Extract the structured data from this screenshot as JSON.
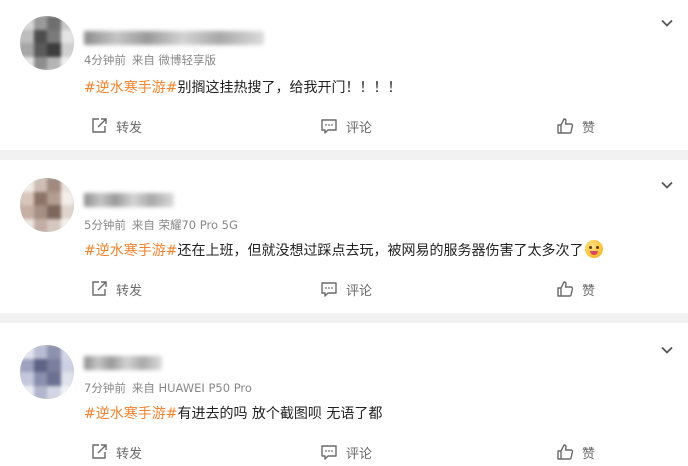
{
  "posts": [
    {
      "meta_time": "4分钟前",
      "meta_source": "来自 微博轻享版",
      "hashtag": "#逆水寒手游#",
      "text": "别搁这挂热搜了，给我开门！！！！",
      "repost_label": "转发",
      "comment_label": "评论",
      "like_label": "赞",
      "avatar_colors": [
        "#d8d8d8",
        "#9a9a9a",
        "#6f6f6f",
        "#c9c9c9",
        "#bdbdbd",
        "#4e4e4e",
        "#7b7b7b",
        "#e3e3e3",
        "#a6a6a6",
        "#5a5a5a",
        "#3d3d3d",
        "#cfcfcf",
        "#e6e6e6",
        "#8e8e8e",
        "#b5b5b5",
        "#f0f0f0"
      ]
    },
    {
      "meta_time": "5分钟前",
      "meta_source": "来自 荣耀70 Pro 5G",
      "hashtag": "#逆水寒手游#",
      "text": "还在上班，但就没想过踩点去玩，被网易的服务器伤害了太多次了",
      "repost_label": "转发",
      "comment_label": "评论",
      "like_label": "赞",
      "avatar_colors": [
        "#f1ece8",
        "#cdbdb4",
        "#a08a80",
        "#ebe3df",
        "#d9c6bb",
        "#8c7367",
        "#b49d91",
        "#f3eeea",
        "#c6afa4",
        "#a58f85",
        "#7e685e",
        "#e0d4ce",
        "#ede6e2",
        "#c2aea4",
        "#d6c7bf",
        "#f5f1ee"
      ]
    },
    {
      "meta_time": "7分钟前",
      "meta_source": "来自 HUAWEI P50 Pro",
      "hashtag": "#逆水寒手游#",
      "text": "有进去的吗 放个截图呗 无语了都",
      "repost_label": "转发",
      "comment_label": "评论",
      "like_label": "赞",
      "avatar_colors": [
        "#e2e4ef",
        "#b9bdd3",
        "#8d92ad",
        "#d5d8e6",
        "#9da2bf",
        "#5f6385",
        "#7a7f9d",
        "#ccd0e2",
        "#c4c8dc",
        "#8a8fae",
        "#6c7192",
        "#e0e2ec",
        "#edeef4",
        "#b2b6cc",
        "#d2d5e3",
        "#f2f3f7"
      ]
    }
  ]
}
